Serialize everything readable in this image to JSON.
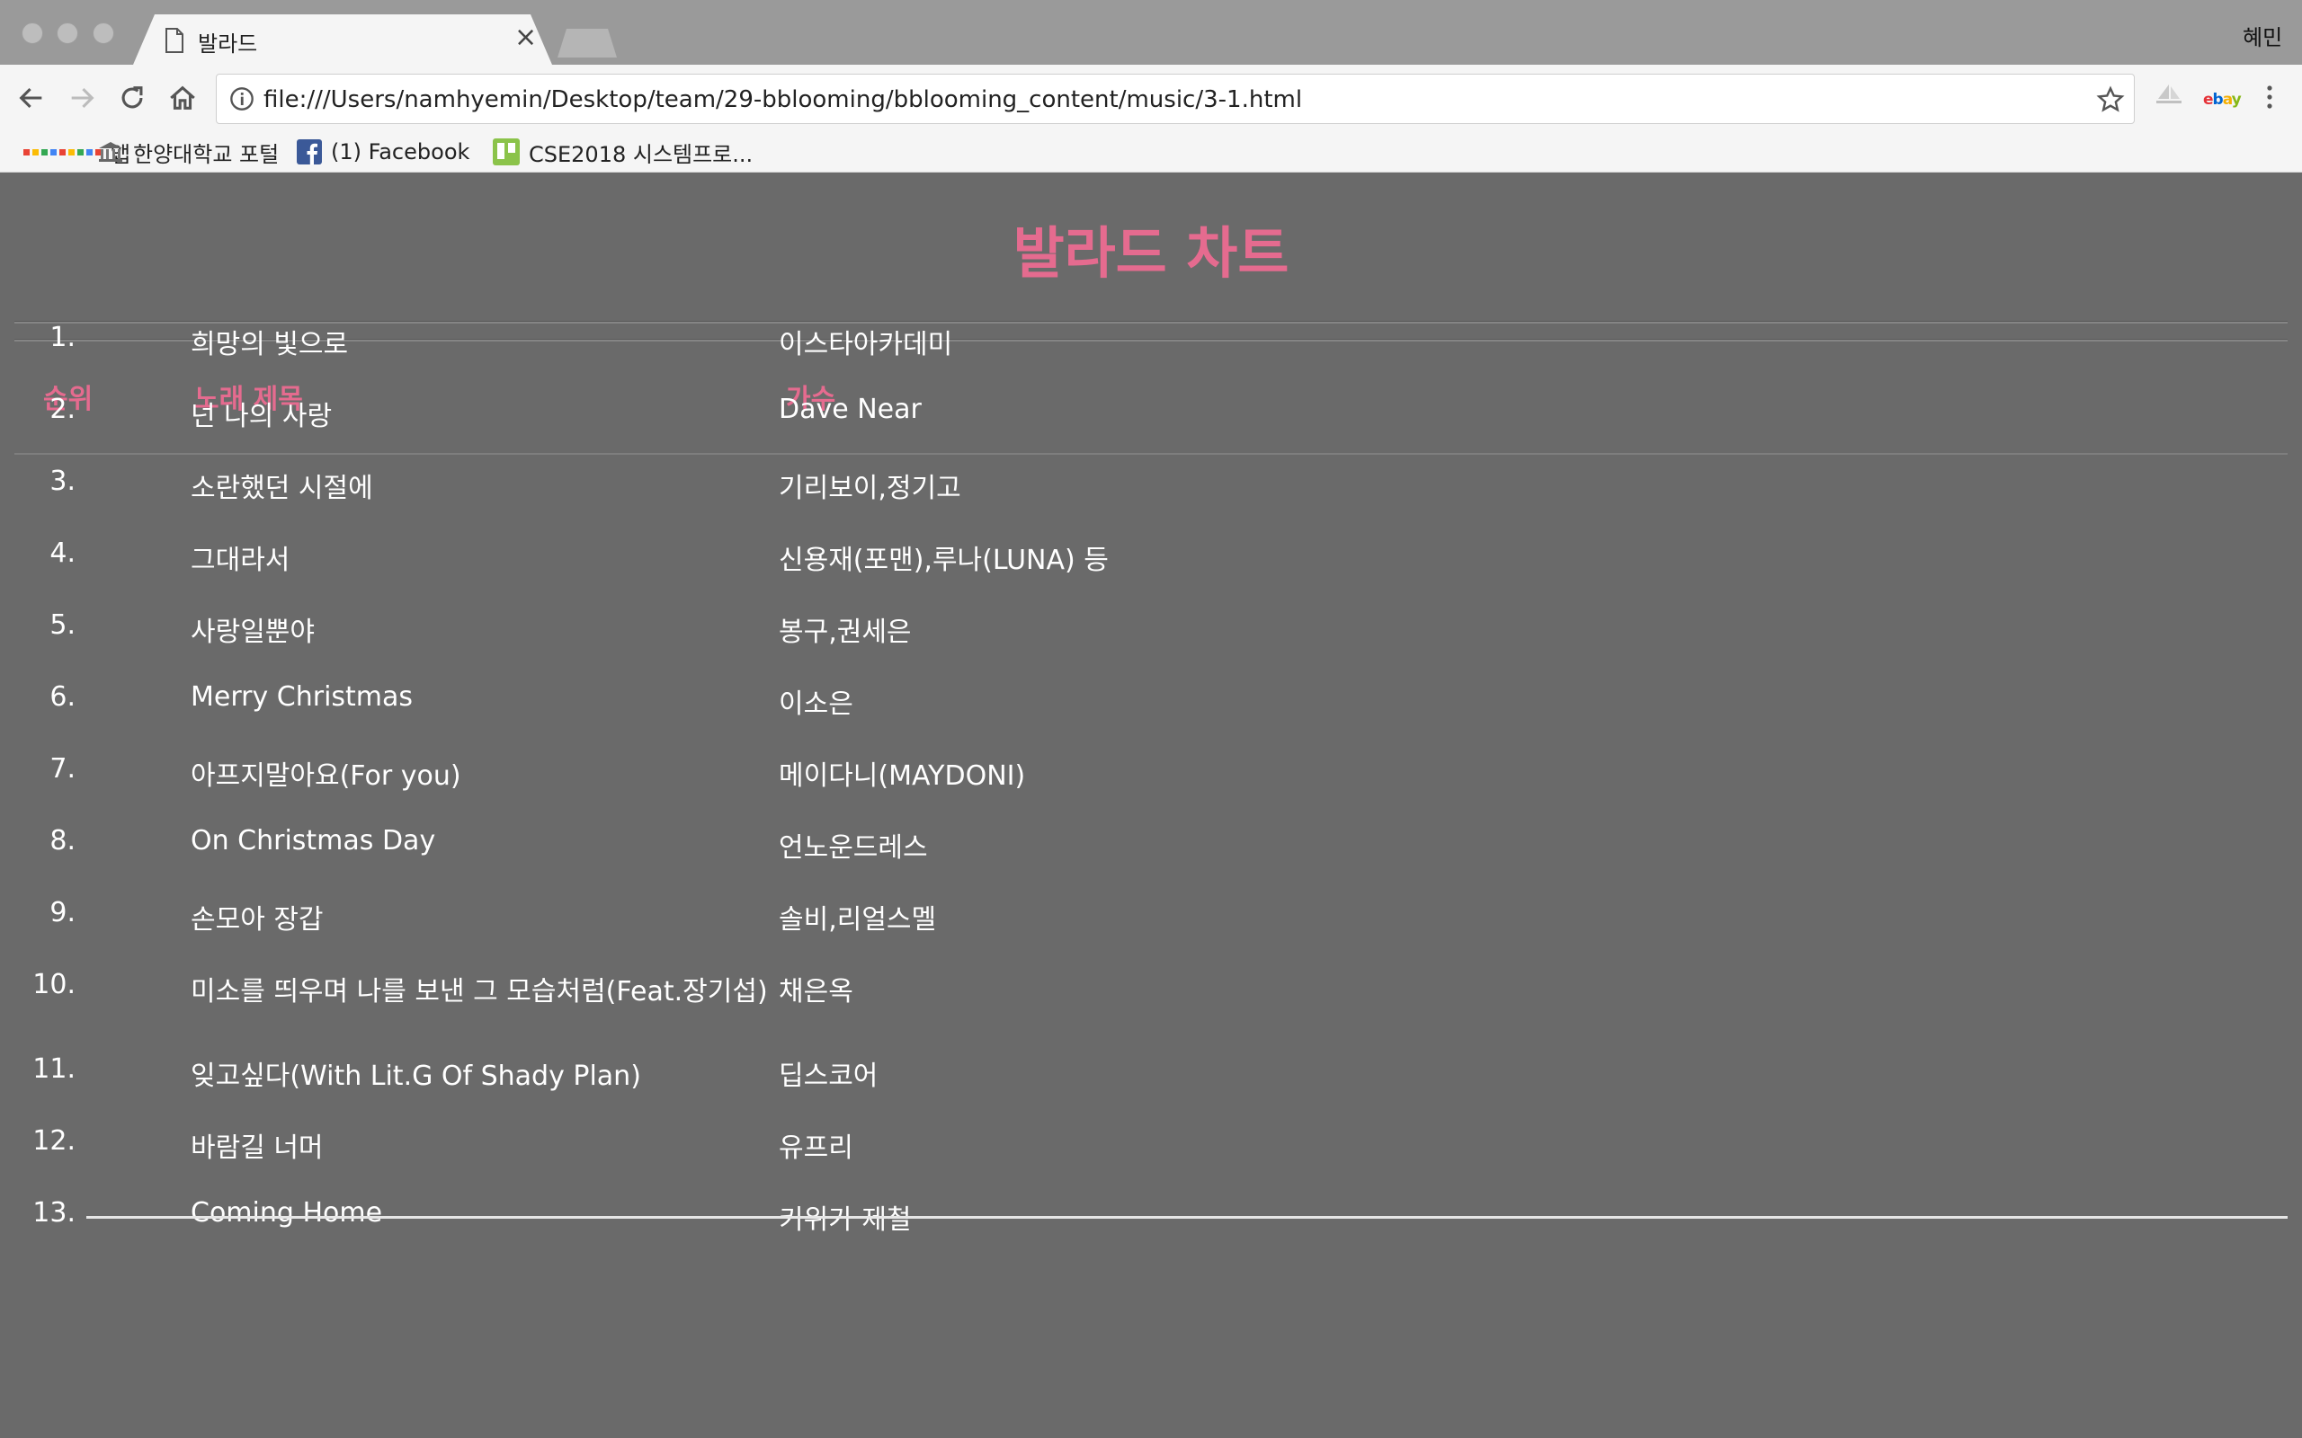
{
  "browser": {
    "tab_title": "발라드",
    "profile_name": "혜민",
    "url": "file:///Users/namhyemin/Desktop/team/29-bblooming/bblooming_content/music/3-1.html",
    "bookmarks": [
      {
        "label": "앱",
        "icon": "apps-grid-icon"
      },
      {
        "label": "한양대학교 포털",
        "icon": "university-icon"
      },
      {
        "label": "(1) Facebook",
        "icon": "facebook-icon"
      },
      {
        "label": "CSE2018 시스템프로...",
        "icon": "trello-icon"
      }
    ],
    "extensions": {
      "ebay_label": "ebay"
    }
  },
  "colors": {
    "accent_pink": "#e56b8f",
    "page_background": "#6a6a6a",
    "text_white": "#ffffff"
  },
  "page": {
    "title": "발라드 차트",
    "columns": {
      "rank": "순위",
      "title": "노래 제목",
      "artist": "가수"
    },
    "songs": [
      {
        "rank": "1.",
        "title": "희망의 빛으로",
        "artist": "이스타아카데미"
      },
      {
        "rank": "2.",
        "title": "넌 나의 사랑",
        "artist": "Dave Near"
      },
      {
        "rank": "3.",
        "title": "소란했던 시절에",
        "artist": "기리보이,정기고"
      },
      {
        "rank": "4.",
        "title": "그대라서",
        "artist": "신용재(포맨),루나(LUNA) 등"
      },
      {
        "rank": "5.",
        "title": "사랑일뿐야",
        "artist": "봉구,권세은"
      },
      {
        "rank": "6.",
        "title": "Merry Christmas",
        "artist": "이소은"
      },
      {
        "rank": "7.",
        "title": "아프지말아요(For you)",
        "artist": "메이다니(MAYDONI)"
      },
      {
        "rank": "8.",
        "title": "On Christmas Day",
        "artist": "언노운드레스"
      },
      {
        "rank": "9.",
        "title": "손모아 장갑",
        "artist": "솔비,리얼스멜"
      },
      {
        "rank": "10.",
        "title": "미소를 띄우며 나를 보낸 그 모습처럼(Feat.장기섭)",
        "artist": "채은옥"
      },
      {
        "rank": "11.",
        "title": "잊고싶다(With Lit.G Of Shady Plan)",
        "artist": "딥스코어"
      },
      {
        "rank": "12.",
        "title": "바람길 너머",
        "artist": "유프리"
      },
      {
        "rank": "13.",
        "title": "Coming Home",
        "artist": "키위가 제철"
      }
    ]
  }
}
